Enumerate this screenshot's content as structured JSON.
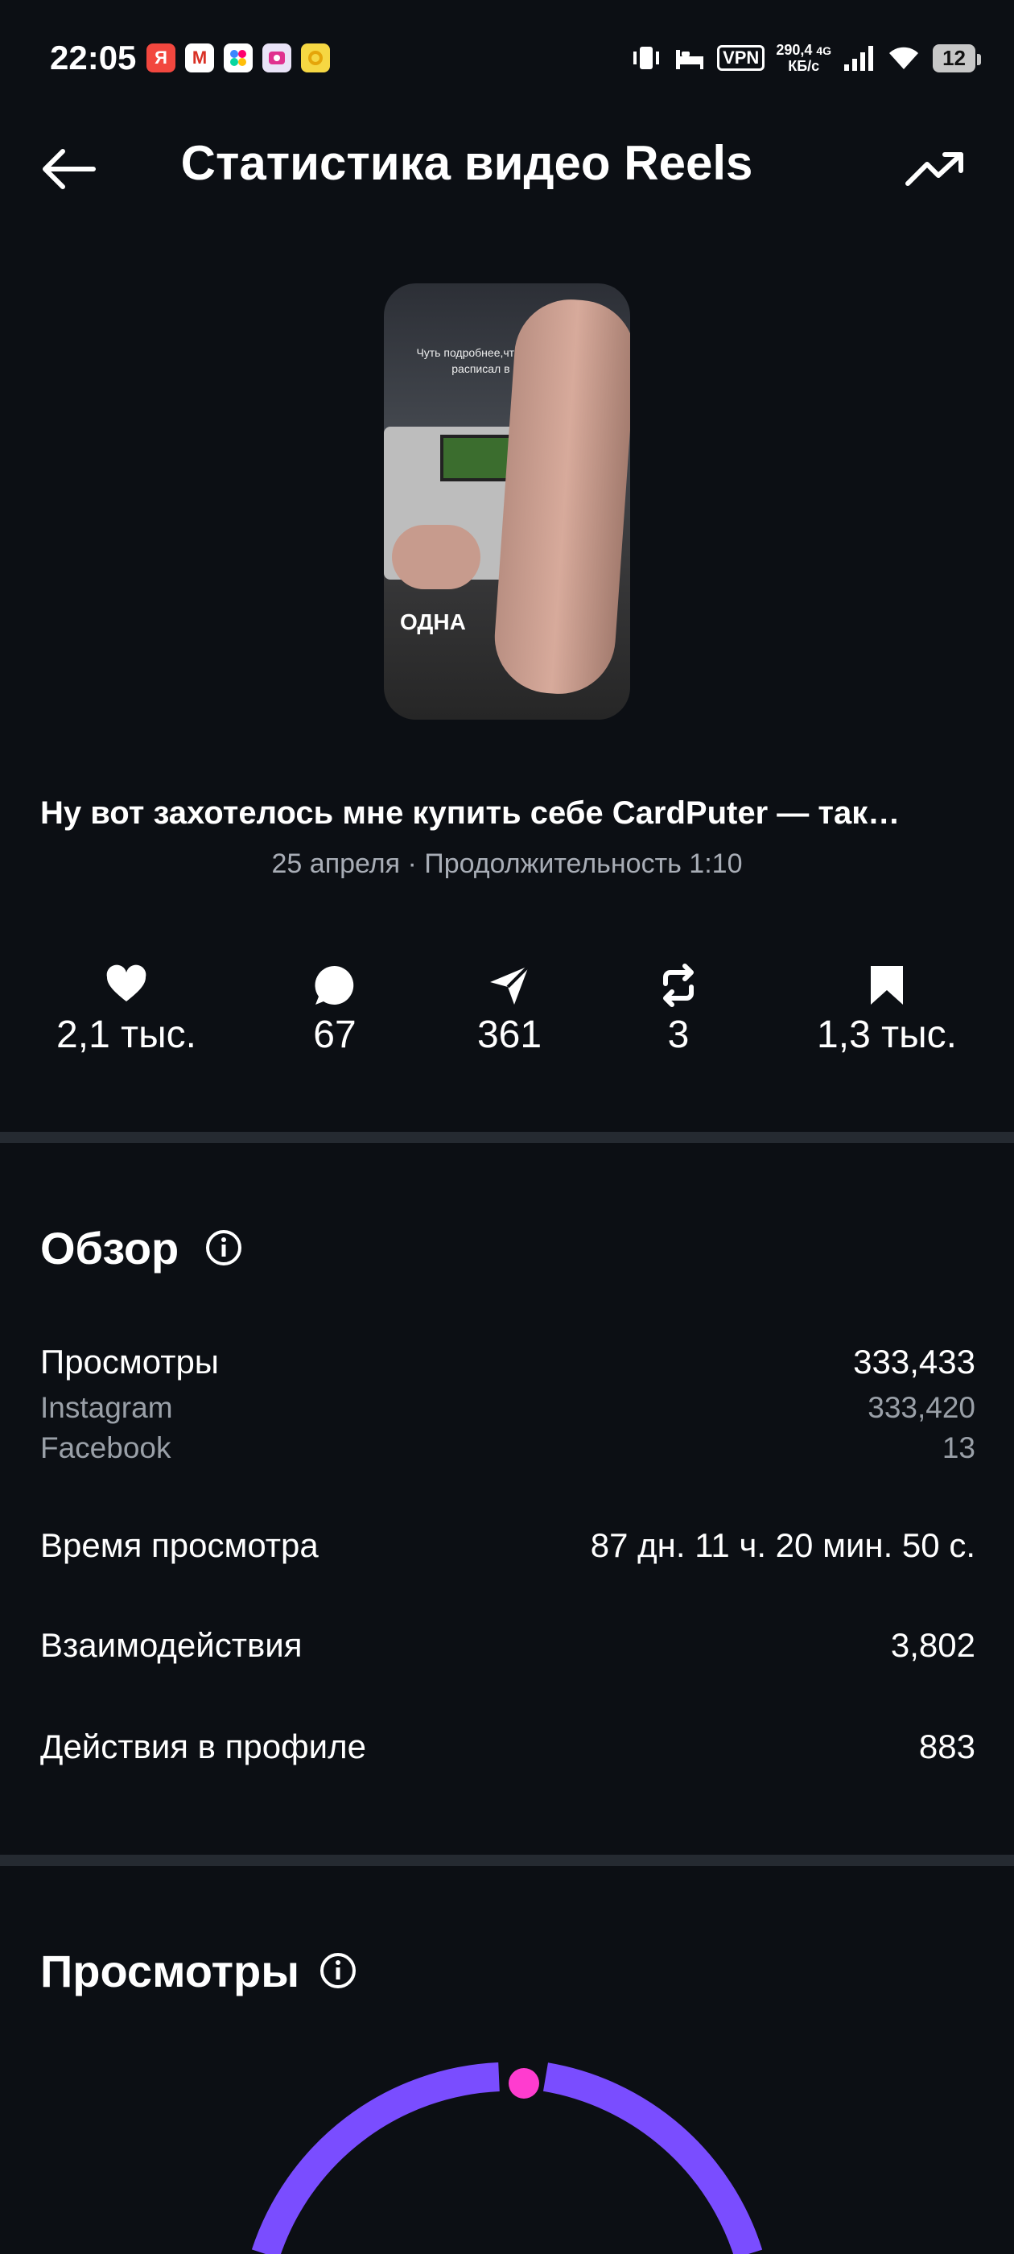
{
  "status_bar": {
    "time": "22:05",
    "speed_value": "290,4",
    "speed_unit": "КБ/с",
    "network": "4G",
    "vpn": "VPN",
    "battery": "12"
  },
  "header": {
    "title": "Статистика видео Reels"
  },
  "video": {
    "thumbnail_caption": "Чуть подробнее,что это и для чего расписал в описании",
    "thumbnail_word": "ОДНА",
    "title": "Ну вот захотелось мне купить себе CardPuter — так…",
    "date": "25 апреля",
    "separator": "·",
    "duration": "Продолжительность 1:10"
  },
  "engagement": {
    "likes": "2,1 тыс.",
    "comments": "67",
    "shares": "361",
    "reposts": "3",
    "saves": "1,3 тыс."
  },
  "overview": {
    "title": "Обзор",
    "views_label": "Просмотры",
    "views_value": "333,433",
    "instagram_label": "Instagram",
    "instagram_value": "333,420",
    "facebook_label": "Facebook",
    "facebook_value": "13",
    "watch_time_label": "Время просмотра",
    "watch_time_value": "87 дн. 11 ч. 20 мин. 50 с.",
    "interactions_label": "Взаимодействия",
    "interactions_value": "3,802",
    "profile_actions_label": "Действия в профиле",
    "profile_actions_value": "883"
  },
  "views_section": {
    "title": "Просмотры"
  },
  "colors": {
    "background": "#0c0f14",
    "arc": "#7a4dff",
    "arc_marker": "#ff3ccf"
  }
}
